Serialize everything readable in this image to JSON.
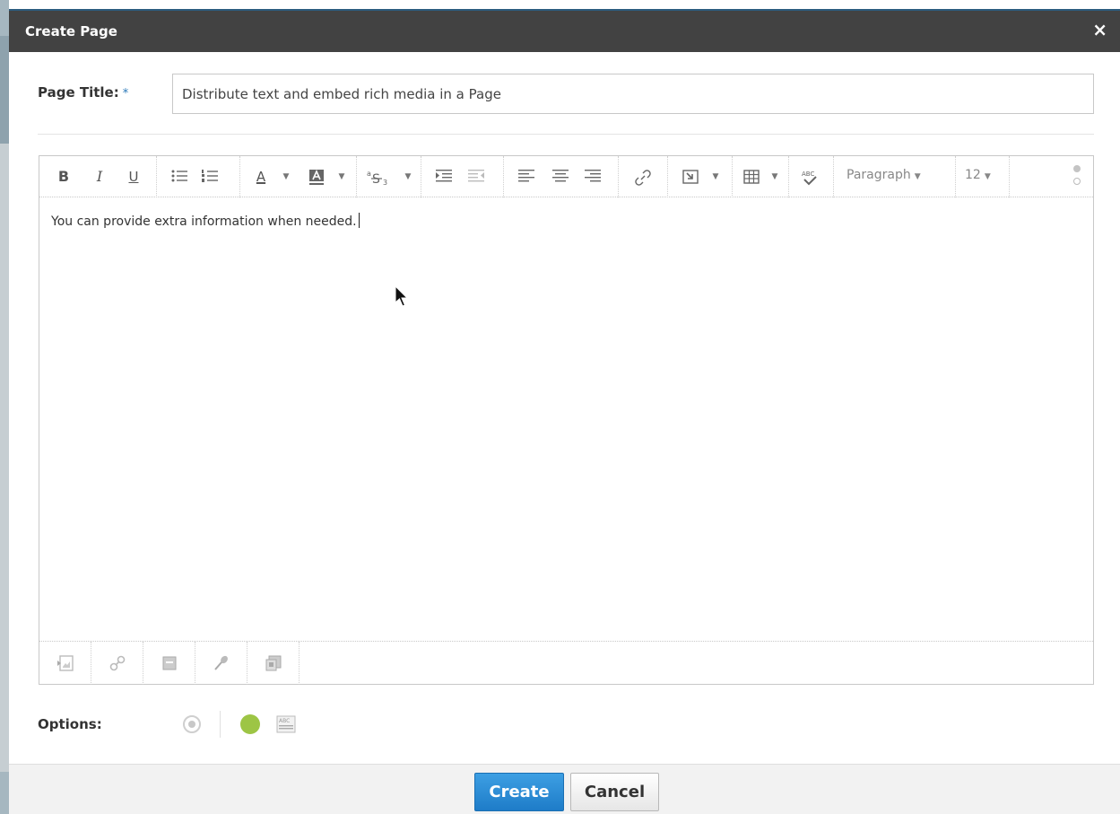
{
  "dialog": {
    "title": "Create Page",
    "close_label": "×"
  },
  "page_title": {
    "label": "Page Title:",
    "required_marker": "*",
    "value": "Distribute text and embed rich media in a Page"
  },
  "editor": {
    "toolbar": {
      "bold": "B",
      "italic": "I",
      "underline": "U",
      "font_color": "A",
      "paragraph_select": "Paragraph",
      "font_size_select": "12",
      "icons": [
        "bullet-list-icon",
        "numbered-list-icon",
        "font-color-icon",
        "highlight-color-icon",
        "superscript-strike-icon",
        "indent-icon",
        "outdent-icon",
        "align-left-icon",
        "align-center-icon",
        "align-right-icon",
        "link-icon",
        "insert-media-icon",
        "table-icon",
        "spellcheck-icon",
        "more-options-icon"
      ]
    },
    "body_text": "You can provide extra information when needed.",
    "bottom_icons": [
      "insert-image-icon",
      "insert-link-icon",
      "archive-icon",
      "microphone-icon",
      "embed-icon"
    ]
  },
  "options": {
    "label": "Options:",
    "status_color": "#9dc545"
  },
  "footer": {
    "create_label": "Create",
    "cancel_label": "Cancel"
  },
  "colors": {
    "titlebar": "#424242",
    "primary": "#1e7cc8"
  }
}
